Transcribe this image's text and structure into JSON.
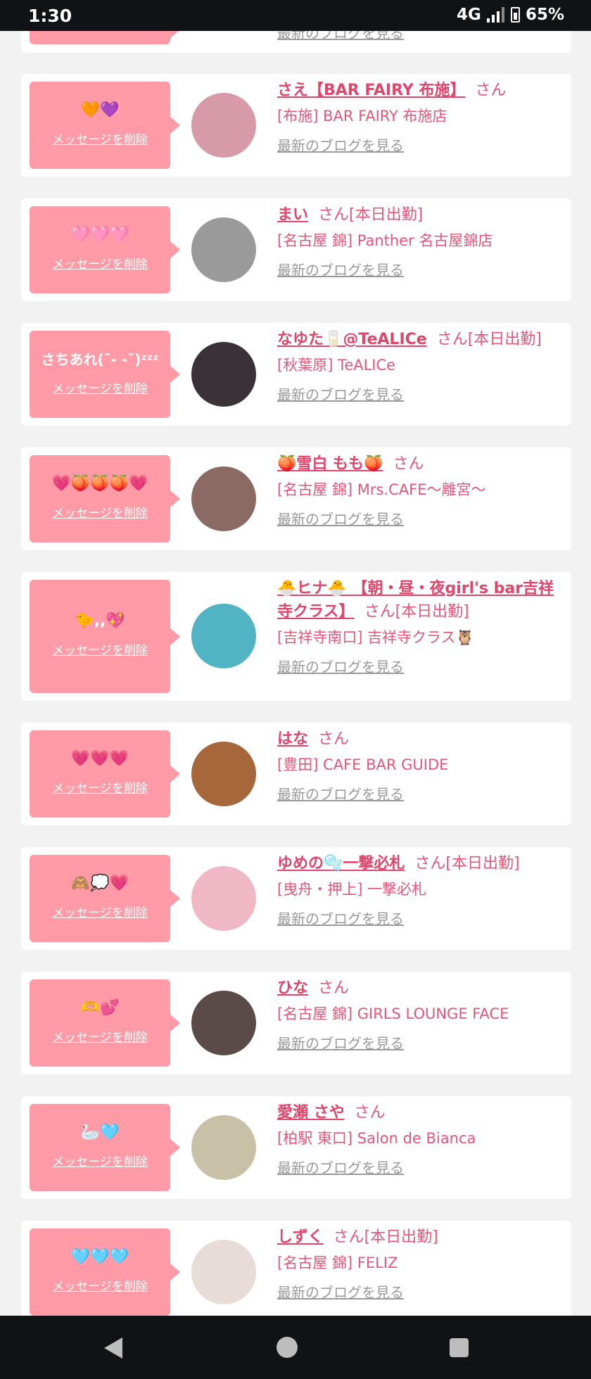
{
  "status": {
    "time": "1:30",
    "network": "4G",
    "battery": "65%"
  },
  "common": {
    "delete_label": "メッセージを削除",
    "blog_label": "最新のブログを見る"
  },
  "cards": [
    {
      "emoji": "🧡💜",
      "name": "さえ【BAR FAIRY 布施】",
      "suffix": "さん",
      "shop": "[布施] BAR FAIRY 布施店",
      "avatar_color": "#d79aa9"
    },
    {
      "emoji": "🩷🩷🩷",
      "name": "まい",
      "suffix": "さん[本日出勤]",
      "shop": "[名古屋 錦] Panther 名古屋錦店",
      "avatar_color": "#9a9a9a"
    },
    {
      "emoji": "さちあれ(˘- -˘)ᶻᶻᶻ",
      "name": "なゆた🥛@TeALICe",
      "suffix": "さん[本日出勤]",
      "shop": "[秋葉原] TeALICe",
      "avatar_color": "#3a3236"
    },
    {
      "emoji": "💗🍑🍑🍑💗",
      "name": "🍑雪白 もも🍑",
      "suffix": "さん",
      "shop": "[名古屋 錦] Mrs.CAFE〜離宮〜",
      "avatar_color": "#8a6a62"
    },
    {
      "emoji": "🐤,,💖",
      "name": "🐣ヒナ🐣 【朝・昼・夜girl's bar吉祥寺クラス】",
      "suffix": "さん[本日出勤]",
      "shop": "[吉祥寺南口] 吉祥寺クラス🦉",
      "avatar_color": "#52b3c4"
    },
    {
      "emoji": "💗💗💗",
      "name": "はな",
      "suffix": "さん",
      "shop": "[豊田] CAFE BAR GUIDE",
      "avatar_color": "#a6683a"
    },
    {
      "emoji": "🙈💭💗",
      "name": "ゆめの🫧一撃必札",
      "suffix": "さん[本日出勤]",
      "shop": "[曳舟・押上] 一撃必札",
      "avatar_color": "#f0b8c4"
    },
    {
      "emoji": "🫶💕",
      "name": "ひな",
      "suffix": "さん",
      "shop": "[名古屋 錦] GIRLS LOUNGE FACE",
      "avatar_color": "#5a4a48"
    },
    {
      "emoji": "🦢🩵",
      "name": "愛瀬 さや",
      "suffix": "さん",
      "shop": "[柏駅 東口] Salon de Bianca",
      "avatar_color": "#c9c0a8"
    },
    {
      "emoji": "🩵🩵🩵",
      "name": "しずく",
      "suffix": "さん[本日出勤]",
      "shop": "[名古屋 錦] FELIZ",
      "avatar_color": "#e8dcd8"
    }
  ]
}
